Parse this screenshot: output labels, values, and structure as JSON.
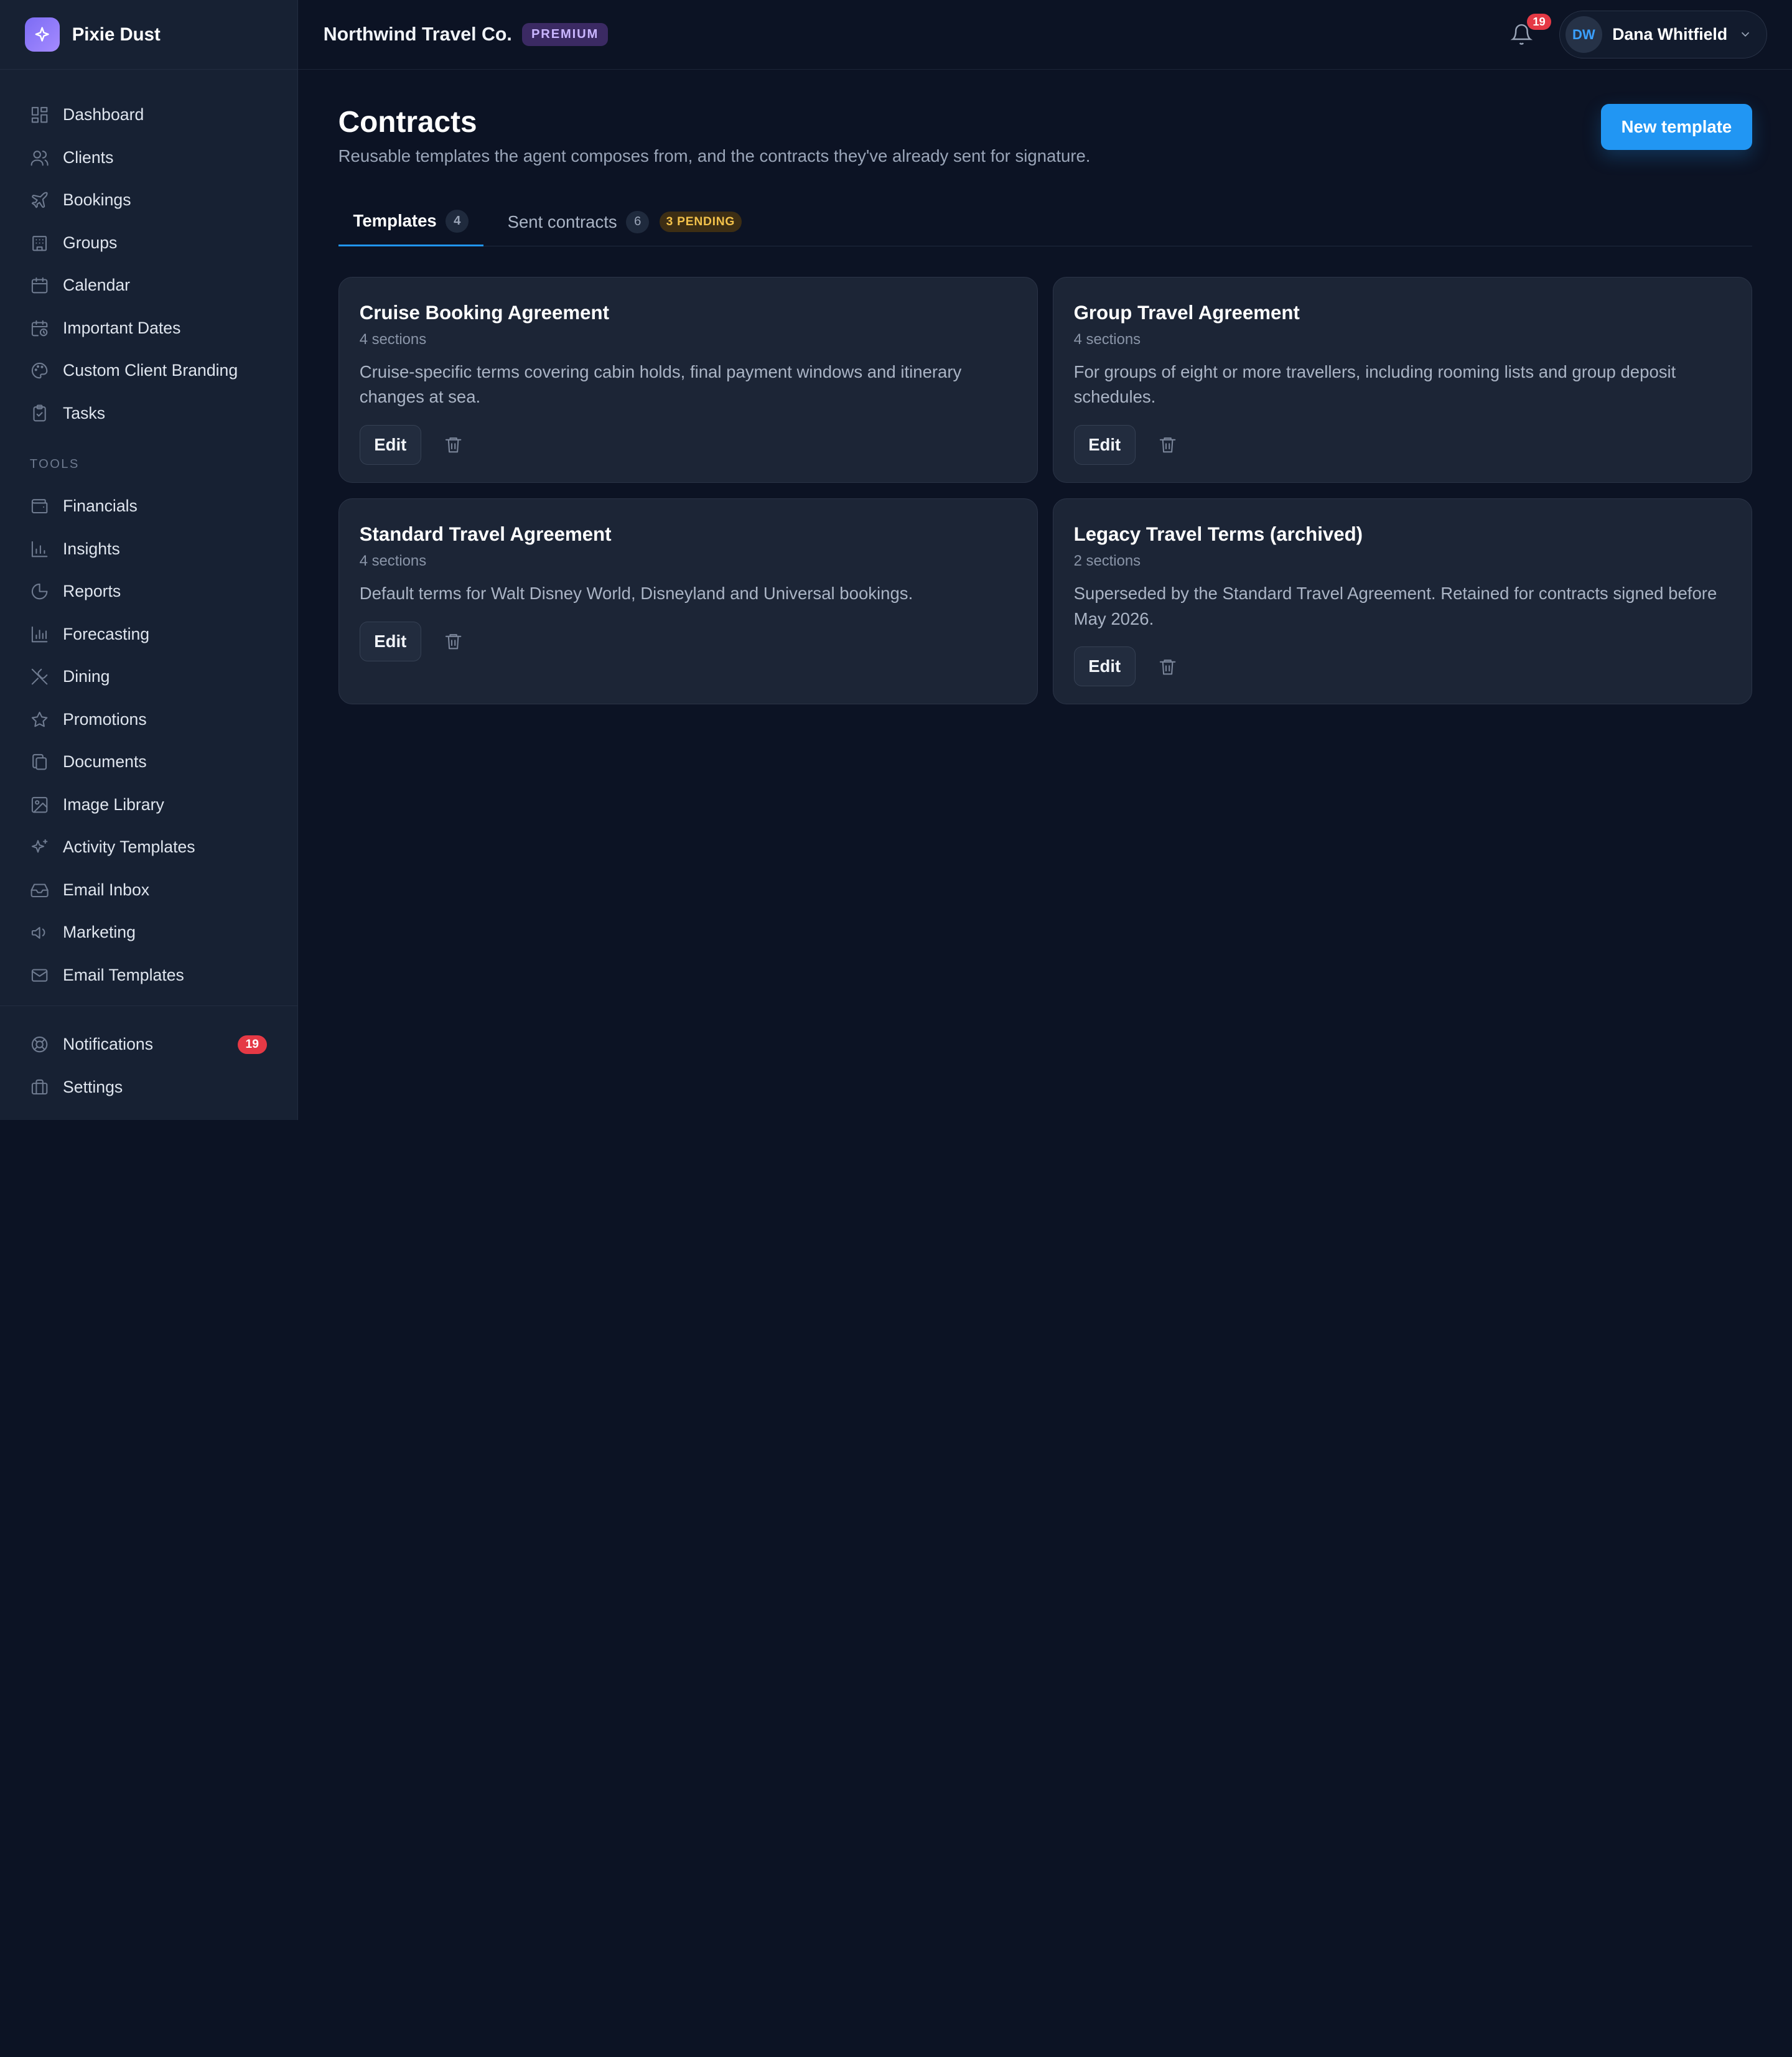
{
  "app": {
    "name": "Pixie Dust",
    "org_name": "Northwind Travel Co.",
    "plan": "PREMIUM"
  },
  "sidebar": {
    "primary": [
      {
        "label": "Dashboard",
        "icon": "dashboard-icon"
      },
      {
        "label": "Clients",
        "icon": "users-icon"
      },
      {
        "label": "Bookings",
        "icon": "plane-icon"
      },
      {
        "label": "Groups",
        "icon": "building-icon"
      },
      {
        "label": "Calendar",
        "icon": "calendar-icon"
      },
      {
        "label": "Important Dates",
        "icon": "calendar-clock-icon"
      },
      {
        "label": "Custom Client Branding",
        "icon": "palette-icon"
      },
      {
        "label": "Tasks",
        "icon": "clipboard-check-icon"
      }
    ],
    "tools_heading": "TOOLS",
    "tools": [
      {
        "label": "Financials",
        "icon": "wallet-icon"
      },
      {
        "label": "Insights",
        "icon": "bar-chart-icon"
      },
      {
        "label": "Reports",
        "icon": "pie-chart-icon"
      },
      {
        "label": "Forecasting",
        "icon": "bar-chart-icon"
      },
      {
        "label": "Dining",
        "icon": "utensils-icon"
      },
      {
        "label": "Promotions",
        "icon": "star-icon"
      },
      {
        "label": "Documents",
        "icon": "files-icon"
      },
      {
        "label": "Image Library",
        "icon": "image-icon"
      },
      {
        "label": "Activity Templates",
        "icon": "sparkles-icon"
      },
      {
        "label": "Email Inbox",
        "icon": "inbox-icon"
      },
      {
        "label": "Marketing",
        "icon": "megaphone-icon"
      },
      {
        "label": "Email Templates",
        "icon": "mail-icon"
      }
    ],
    "footer": [
      {
        "label": "Notifications",
        "icon": "lifebuoy-icon",
        "badge": "19"
      },
      {
        "label": "Settings",
        "icon": "briefcase-icon"
      }
    ]
  },
  "topbar": {
    "notification_count": "19",
    "user": {
      "initials": "DW",
      "name": "Dana Whitfield"
    }
  },
  "page": {
    "title": "Contracts",
    "subtitle": "Reusable templates the agent composes from, and the contracts they've already sent for signature.",
    "new_button_label": "New template"
  },
  "tabs": [
    {
      "label": "Templates",
      "count": "4",
      "active": true
    },
    {
      "label": "Sent contracts",
      "count": "6",
      "badge": "3 PENDING",
      "active": false
    }
  ],
  "templates": [
    {
      "title": "Cruise Booking Agreement",
      "sections": "4 sections",
      "description": "Cruise-specific terms covering cabin holds, final payment windows and itinerary changes at sea.",
      "edit_label": "Edit"
    },
    {
      "title": "Group Travel Agreement",
      "sections": "4 sections",
      "description": "For groups of eight or more travellers, including rooming lists and group deposit schedules.",
      "edit_label": "Edit"
    },
    {
      "title": "Standard Travel Agreement",
      "sections": "4 sections",
      "description": "Default terms for Walt Disney World, Disneyland and Universal bookings.",
      "edit_label": "Edit"
    },
    {
      "title": "Legacy Travel Terms (archived)",
      "sections": "2 sections",
      "description": "Superseded by the Standard Travel Agreement. Retained for contracts signed before May 2026.",
      "edit_label": "Edit"
    }
  ],
  "colors": {
    "accent": "#2196f3",
    "danger": "#e53945",
    "plan": "#c9b5ff",
    "pending": "#f2c14b"
  }
}
